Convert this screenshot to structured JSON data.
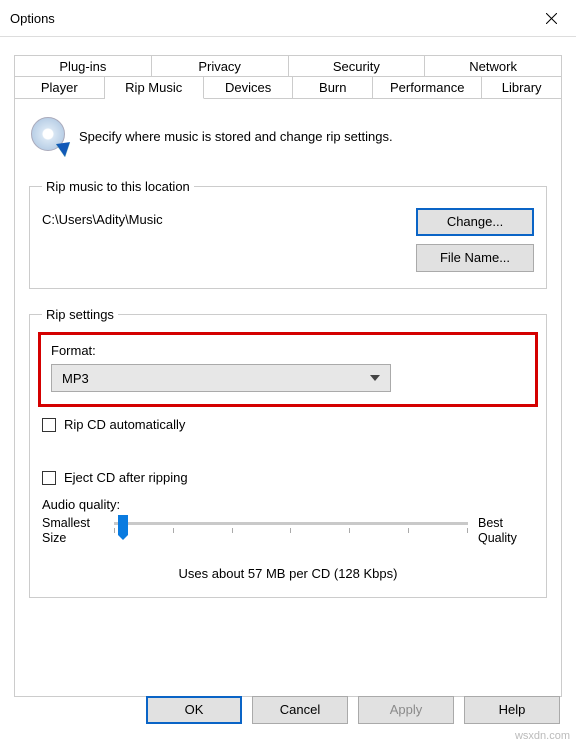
{
  "window": {
    "title": "Options"
  },
  "tabs_back": [
    "Plug-ins",
    "Privacy",
    "Security",
    "Network"
  ],
  "tabs_front": [
    "Player",
    "Rip Music",
    "Devices",
    "Burn",
    "Performance",
    "Library"
  ],
  "active_tab_index": 1,
  "intro_text": "Specify where music is stored and change rip settings.",
  "location": {
    "legend": "Rip music to this location",
    "path": "C:\\Users\\Adity\\Music",
    "change": "Change...",
    "filename": "File Name..."
  },
  "settings": {
    "legend": "Rip settings",
    "format_label": "Format:",
    "format_value": "MP3",
    "rip_auto": "Rip CD automatically",
    "eject": "Eject CD after ripping",
    "audio_quality": "Audio quality:",
    "smallest": "Smallest Size",
    "best": "Best Quality",
    "usage": "Uses about 57 MB per CD (128 Kbps)"
  },
  "buttons": {
    "ok": "OK",
    "cancel": "Cancel",
    "apply": "Apply",
    "help": "Help"
  },
  "watermark": "wsxdn.com"
}
